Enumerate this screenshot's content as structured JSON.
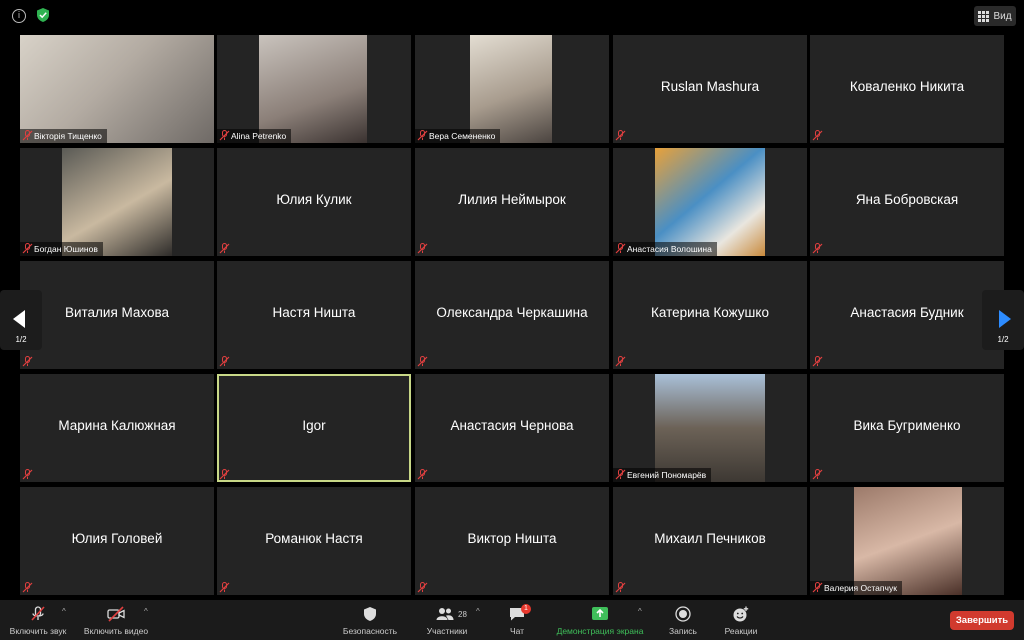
{
  "topbar": {
    "info": "i",
    "view_label": "Вид"
  },
  "participants": [
    {
      "name": "Вікторія Тищенко",
      "video": true
    },
    {
      "name": "Alina Petrenko",
      "video": true
    },
    {
      "name": "Вера Семененко",
      "video": true
    },
    {
      "name": "Ruslan Mashura",
      "video": false
    },
    {
      "name": "Коваленко Никита",
      "video": false
    },
    {
      "name": "Богдан Юшинов",
      "video": true
    },
    {
      "name": "Юлия Кулик",
      "video": false
    },
    {
      "name": "Лилия Неймырок",
      "video": false
    },
    {
      "name": "Анастасия Волошина",
      "video": true
    },
    {
      "name": "Яна Бобровская",
      "video": false
    },
    {
      "name": "Виталия Махова",
      "video": false
    },
    {
      "name": "Настя Ништа",
      "video": false
    },
    {
      "name": "Олександра Черкашина",
      "video": false
    },
    {
      "name": "Катерина Кожушко",
      "video": false
    },
    {
      "name": "Анастасия Будник",
      "video": false
    },
    {
      "name": "Марина Калюжная",
      "video": false
    },
    {
      "name": "Igor",
      "video": false,
      "active": true
    },
    {
      "name": "Анастасия Чернова",
      "video": false
    },
    {
      "name": "Евгений Пономарёв",
      "video": true
    },
    {
      "name": "Вика Бугрименко",
      "video": false
    },
    {
      "name": "Юлия Головей",
      "video": false
    },
    {
      "name": "Романюк Настя",
      "video": false
    },
    {
      "name": "Виктор Ништа",
      "video": false
    },
    {
      "name": "Михаил Печников",
      "video": false
    },
    {
      "name": "Валерия Остапчук",
      "video": true
    }
  ],
  "pagination": {
    "left": "1/2",
    "right": "1/2"
  },
  "toolbar": {
    "mute": "Включить звук",
    "video": "Включить видео",
    "security": "Безопасность",
    "participants": "Участники",
    "participants_count": "28",
    "chat": "Чат",
    "chat_badge": "1",
    "share": "Демонстрация экрана",
    "record": "Запись",
    "reactions": "Реакции",
    "end": "Завершить"
  },
  "colors": {
    "accent_green": "#3fbf5a",
    "end_red": "#d13a2e",
    "active_border": "#c8d887",
    "muted_red": "#e04040"
  }
}
